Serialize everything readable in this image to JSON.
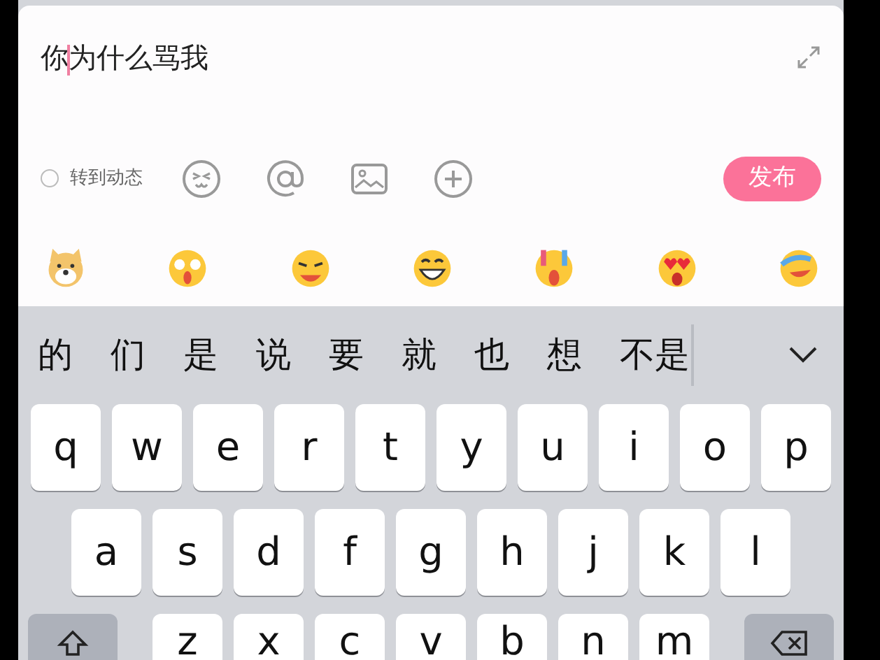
{
  "composer": {
    "text": "你为什么骂我",
    "repost": {
      "label": "转到动态",
      "checked": false
    },
    "post_button": "发布"
  },
  "emoji_bar": [
    {
      "kind": "dog"
    },
    {
      "kind": "starry"
    },
    {
      "kind": "drool"
    },
    {
      "kind": "grin"
    },
    {
      "kind": "cry"
    },
    {
      "kind": "hearts"
    },
    {
      "kind": "laugh"
    }
  ],
  "keyboard": {
    "candidates": [
      "的",
      "们",
      "是",
      "说",
      "要",
      "就",
      "也",
      "想",
      "不是"
    ],
    "rows": [
      [
        "q",
        "w",
        "e",
        "r",
        "t",
        "y",
        "u",
        "i",
        "o",
        "p"
      ],
      [
        "a",
        "s",
        "d",
        "f",
        "g",
        "h",
        "j",
        "k",
        "l"
      ],
      [
        "z",
        "x",
        "c",
        "v",
        "b",
        "n",
        "m"
      ]
    ]
  }
}
